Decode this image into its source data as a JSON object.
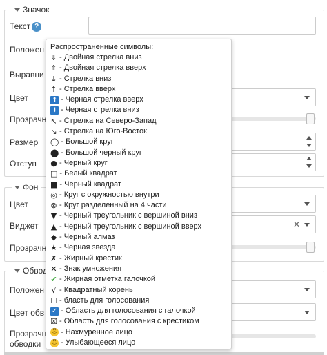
{
  "sections": {
    "badge": {
      "title": "Значок",
      "rows": {
        "text": "Текст",
        "position": "Положен",
        "align": "Выравни",
        "color": "Цвет",
        "opacity": "Прозрачн",
        "size": "Размер",
        "offset": "Отступ"
      }
    },
    "background": {
      "title": "Фон",
      "rows": {
        "color": "Цвет",
        "widget": "Виджет",
        "opacity": "Прозрачн"
      }
    },
    "outline": {
      "title": "Обвод",
      "rows": {
        "position": "Положен",
        "color": "Цвет обв",
        "opacity_line1": "Прозрачн",
        "opacity_line2": "обводки"
      }
    }
  },
  "help_icon": "?",
  "popup": {
    "title": "Распространенные символы:",
    "items": [
      {
        "glyph": "⇓",
        "label": "- Двойная стрелка вниз"
      },
      {
        "glyph": "⇑",
        "label": "- Двойная стрелка вверх"
      },
      {
        "glyph": "↓",
        "label": "- Стрелка вниз"
      },
      {
        "glyph": "↑",
        "label": "- Стрелка вверх"
      },
      {
        "glyph": "⬆",
        "label": "- Черная стрелка вверх"
      },
      {
        "glyph": "⬇",
        "label": "- Черная стрелка вниз"
      },
      {
        "glyph": "↖",
        "label": "- Стрелка на Северо-Запад"
      },
      {
        "glyph": "↘",
        "label": "- Стрелка на Юго-Восток"
      },
      {
        "glyph": "◯",
        "label": "- Большой круг"
      },
      {
        "glyph": "⬤",
        "label": "- Большой черный круг"
      },
      {
        "glyph": "●",
        "label": "- Черный круг"
      },
      {
        "glyph": "□",
        "label": "- Белый квадрат"
      },
      {
        "glyph": "■",
        "label": "- Черный квадрат"
      },
      {
        "glyph": "◎",
        "label": "- Круг с окружностью внутри"
      },
      {
        "glyph": "⊗",
        "label": "- Круг разделенный на 4 части"
      },
      {
        "glyph": "▼",
        "label": "- Черный треугольник с вершиной вниз"
      },
      {
        "glyph": "▲",
        "label": "- Черный треугольник с вершиной вверх"
      },
      {
        "glyph": "◆",
        "label": "- Черный алмаз"
      },
      {
        "glyph": "★",
        "label": "- Черная звезда"
      },
      {
        "glyph": "✗",
        "label": "- Жирный крестик"
      },
      {
        "glyph": "✕",
        "label": "- Знак умножения"
      },
      {
        "glyph": "✔",
        "label": "- Жирная отметка галочкой"
      },
      {
        "glyph": "√",
        "label": "- Квадратный корень"
      },
      {
        "glyph": "☐",
        "label": "- бласть для голосования"
      },
      {
        "glyph": "✓",
        "label": "- Область для голосования с галочкой"
      },
      {
        "glyph": "☒",
        "label": "- Область для голосования с крестиком"
      },
      {
        "glyph": "☹",
        "label": "- Нахмуренное лицо"
      },
      {
        "glyph": "☺",
        "label": "- Улыбающееся лицо"
      }
    ]
  },
  "colors": {
    "accent_blue": "#2b78c6",
    "check_green": "#3aa53a",
    "face_yellow": "#f5c431",
    "border": "#d9d9d9"
  }
}
